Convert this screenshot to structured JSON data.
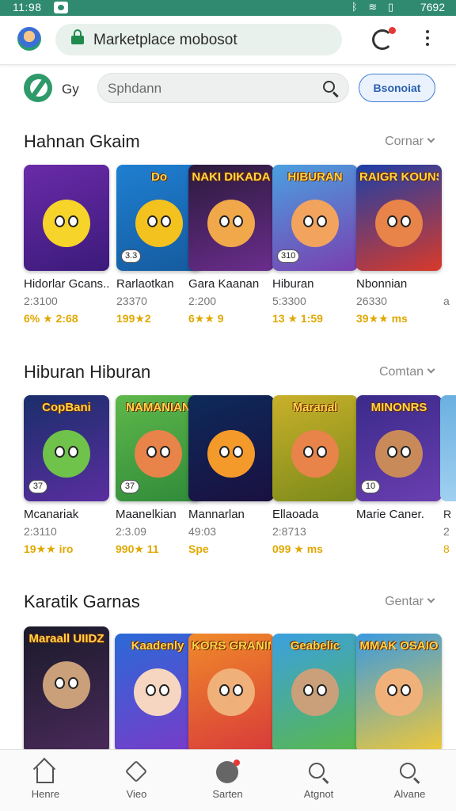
{
  "status_bar": {
    "time": "11:98",
    "right_text": "7692",
    "icons": [
      "app-icon",
      "bluetooth-icon",
      "wifi-icon",
      "sim-icon"
    ]
  },
  "browser": {
    "url": "Marketplace mobosot",
    "icons": [
      "avatar",
      "lock-icon",
      "refresh-icon",
      "more-vert-icon"
    ]
  },
  "header": {
    "brand": "Gy",
    "search_placeholder": "Sphdann",
    "button_label": "Bsonoiat"
  },
  "sections": [
    {
      "title": "Hahnan Gkaim",
      "more_label": "Cornar",
      "items": [
        {
          "thumb_title": "",
          "badge": "",
          "name": "Hidorlar Gcans..",
          "meta": "2:3100",
          "rating": "6% ★ 2:68",
          "colors": [
            "#6a2ba8",
            "#3b1a7a"
          ],
          "char": "#f6d42a"
        },
        {
          "thumb_title": "Do",
          "badge": "3.3",
          "name": "Rarlaotkan",
          "meta": "23370",
          "rating": "199★2",
          "colors": [
            "#1f7fd1",
            "#155a9e"
          ],
          "char": "#f4c21f"
        },
        {
          "thumb_title": "NAKI DIKADA",
          "badge": "",
          "name": "Gara Kaanan",
          "meta": "2:200",
          "rating": "6★★ 9",
          "colors": [
            "#2a1a3a",
            "#6b2d8e"
          ],
          "char": "#f0a84a"
        },
        {
          "thumb_title": "HIBURAN",
          "badge": "310",
          "name": "Hiburan",
          "meta": "5:3300",
          "rating": "13 ★ 1:59",
          "colors": [
            "#4aa0e0",
            "#7a3fb0"
          ],
          "char": "#f2a35e"
        },
        {
          "thumb_title": "RAIGR KOUNSHA",
          "badge": "",
          "name": "Nbonnian",
          "meta": "26330",
          "rating": "39★★ ms",
          "colors": [
            "#1b3fa8",
            "#d83a2a"
          ],
          "char": "#e8834a"
        }
      ]
    },
    {
      "title": "Hiburan Hiburan",
      "more_label": "Comtan",
      "items": [
        {
          "thumb_title": "CopBani",
          "badge": "37",
          "name": "Mcanariak",
          "meta": "2:3110",
          "rating": "19★★ iro",
          "colors": [
            "#1a2e6a",
            "#5a2ea0"
          ],
          "char": "#6fc24a"
        },
        {
          "thumb_title": "NAMANIAN",
          "badge": "37",
          "name": "Maanelkian",
          "meta": "2:3.09",
          "rating": "990★ 11",
          "colors": [
            "#5fb84a",
            "#2f8a3a"
          ],
          "char": "#e8834a"
        },
        {
          "thumb_title": "",
          "badge": "",
          "name": "Mannarlan",
          "meta": "49:03",
          "rating": "Spe",
          "colors": [
            "#0d2a5a",
            "#1a1040"
          ],
          "char": "#f39a2a"
        },
        {
          "thumb_title": "Maranal",
          "badge": "",
          "name": "Ellaoada",
          "meta": "2:8713",
          "rating": "099 ★ ms",
          "colors": [
            "#c9b02a",
            "#7a8a1a"
          ],
          "char": "#e8834a"
        },
        {
          "thumb_title": "MINONRS",
          "badge": "10",
          "name": "Marie Caner.",
          "meta": "",
          "rating": "",
          "colors": [
            "#3a2a8a",
            "#6a3fb0"
          ],
          "char": "#c98a5a"
        }
      ]
    },
    {
      "title": "Karatik Garnas",
      "more_label": "Gentar",
      "items": [
        {
          "thumb_title": "Maraall UIIDZ",
          "badge": "",
          "name": "",
          "meta": "",
          "rating": "",
          "colors": [
            "#1a1a2a",
            "#4a2a5a"
          ],
          "char": "#c9a07a"
        },
        {
          "thumb_title": "Kaadenly",
          "badge": "",
          "name": "",
          "meta": "",
          "rating": "",
          "colors": [
            "#2a6ad8",
            "#7a3ac8"
          ],
          "char": "#f6d6c0"
        },
        {
          "thumb_title": "KORS GRANING",
          "badge": "",
          "name": "",
          "meta": "",
          "rating": "",
          "colors": [
            "#f08a2a",
            "#d83a3a"
          ],
          "char": "#f0b07a"
        },
        {
          "thumb_title": "Geabelic",
          "badge": "",
          "name": "",
          "meta": "",
          "rating": "",
          "colors": [
            "#3aa0e0",
            "#5ab84a"
          ],
          "char": "#c9a07a"
        },
        {
          "thumb_title": "MMAK OSAIO",
          "badge": "",
          "name": "",
          "meta": "",
          "rating": "",
          "colors": [
            "#3a9ae0",
            "#f0c83a"
          ],
          "char": "#f0b07a"
        }
      ]
    }
  ],
  "partial_items": [
    {
      "name": "a",
      "meta": "",
      "rating": ""
    },
    {
      "name": "R",
      "meta": "2",
      "rating": "8"
    }
  ],
  "nav": [
    {
      "label": "Henre",
      "icon": "home-icon"
    },
    {
      "label": "Vieo",
      "icon": "tag-icon"
    },
    {
      "label": "Sarten",
      "icon": "games-icon"
    },
    {
      "label": "Atgnot",
      "icon": "discover-icon"
    },
    {
      "label": "Alvane",
      "icon": "search-icon"
    }
  ]
}
